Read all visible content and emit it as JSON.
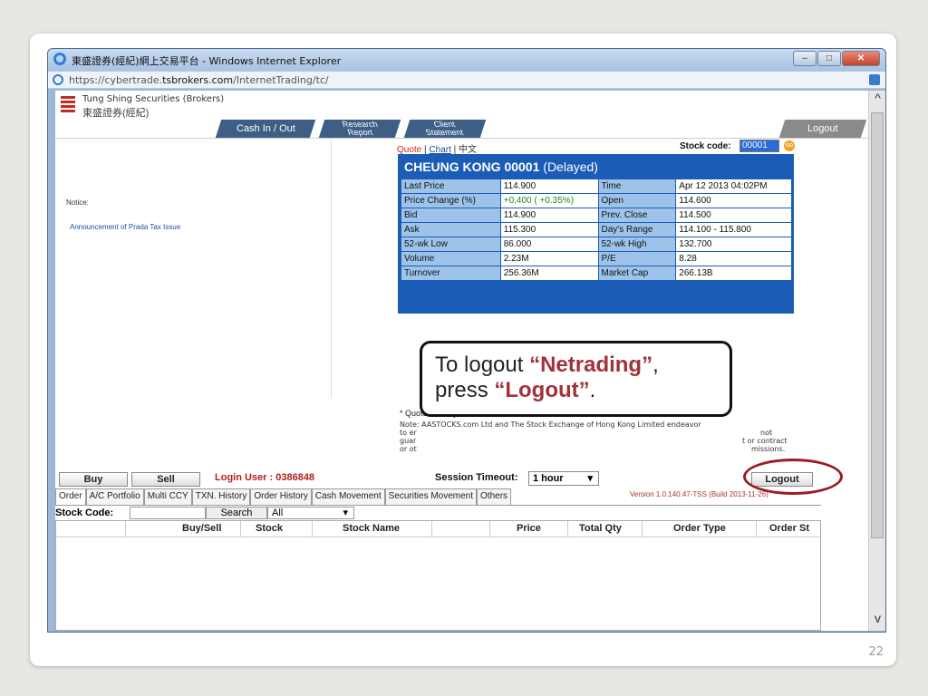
{
  "window": {
    "title": "東盛證券(經紀)網上交易平台 - Windows Internet Explorer",
    "url_prefix": "https://cybertrade.",
    "url_domain": "tsbrokers.com",
    "url_path": "/InternetTrading/tc/",
    "minimize": "–",
    "maximize": "□",
    "close": "✕"
  },
  "header": {
    "company_en": "Tung Shing Securities (Brokers)",
    "company_zh": "東盛證券(經紀)",
    "tabs": {
      "cash": "Cash In / Out",
      "research_1": "Research",
      "research_2": "Report",
      "client_1": "Client",
      "client_2": "Statement",
      "logout": "Logout"
    }
  },
  "left_panel": {
    "notice": "Notice:",
    "announcement": "Announcement of Prada Tax Issue"
  },
  "quote": {
    "link_quote": "Quote",
    "link_chart": "Chart",
    "link_zh": "中文",
    "stock_code_label": "Stock code:",
    "stock_code_value": "00001",
    "go": "GO",
    "title_name": "CHEUNG KONG 00001",
    "title_suffix": " (Delayed)",
    "rows": [
      {
        "l1": "Last Price",
        "v1": "114.900",
        "l2": "Time",
        "v2": "Apr 12 2013 04:02PM"
      },
      {
        "l1": "Price Change (%)",
        "v1": "+0.400 ( +0.35%)",
        "l2": "Open",
        "v2": "114.600"
      },
      {
        "l1": "Bid",
        "v1": "114.900",
        "l2": "Prev. Close",
        "v2": "114.500"
      },
      {
        "l1": "Ask",
        "v1": "115.300",
        "l2": "Day's Range",
        "v2": "114.100 - 115.800"
      },
      {
        "l1": "52-wk Low",
        "v1": "86.000",
        "l2": "52-wk High",
        "v2": "132.700"
      },
      {
        "l1": "Volume",
        "v1": "2.23M",
        "l2": "P/E",
        "v2": "8.28"
      },
      {
        "l1": "Turnover",
        "v1": "256.36M",
        "l2": "Market Cap",
        "v2": "266.13B"
      }
    ],
    "delayed_note": "* Quote is delayed for at least 15 mins",
    "note_l1": "Note: AASTOCKS.com Ltd and The Stock Exchange of Hong Kong Limited endeavor",
    "note_l2": "to er",
    "note_l2_end": "not",
    "note_l3": "guar",
    "note_l3_end": "t or contract",
    "note_l4": "or ot",
    "note_l4_end": "missions."
  },
  "callout": {
    "line1_pre": "To logout ",
    "line1_em": "“Netrading”",
    "line1_post": ",",
    "line2_pre": "press ",
    "line2_em": "“Logout”",
    "line2_post": "."
  },
  "trading": {
    "buy": "Buy",
    "sell": "Sell",
    "login_user": "Login User : 0386848",
    "session_label": "Session Timeout:",
    "session_value": "1 hour",
    "logout": "Logout",
    "version": "Version 1.0.140.47-TSS (Build 2013-11-26)",
    "tabs": [
      "Order",
      "A/C Portfolio",
      "Multi CCY",
      "TXN. History",
      "Order History",
      "Cash Movement",
      "Securities Movement",
      "Others"
    ],
    "stock_code_label": "Stock Code:",
    "search": "Search",
    "filter_value": "All",
    "columns": [
      "Buy/Sell",
      "Stock",
      "Stock Name",
      "Price",
      "Total Qty",
      "Order Type",
      "Order St"
    ]
  },
  "slide_number": "22"
}
